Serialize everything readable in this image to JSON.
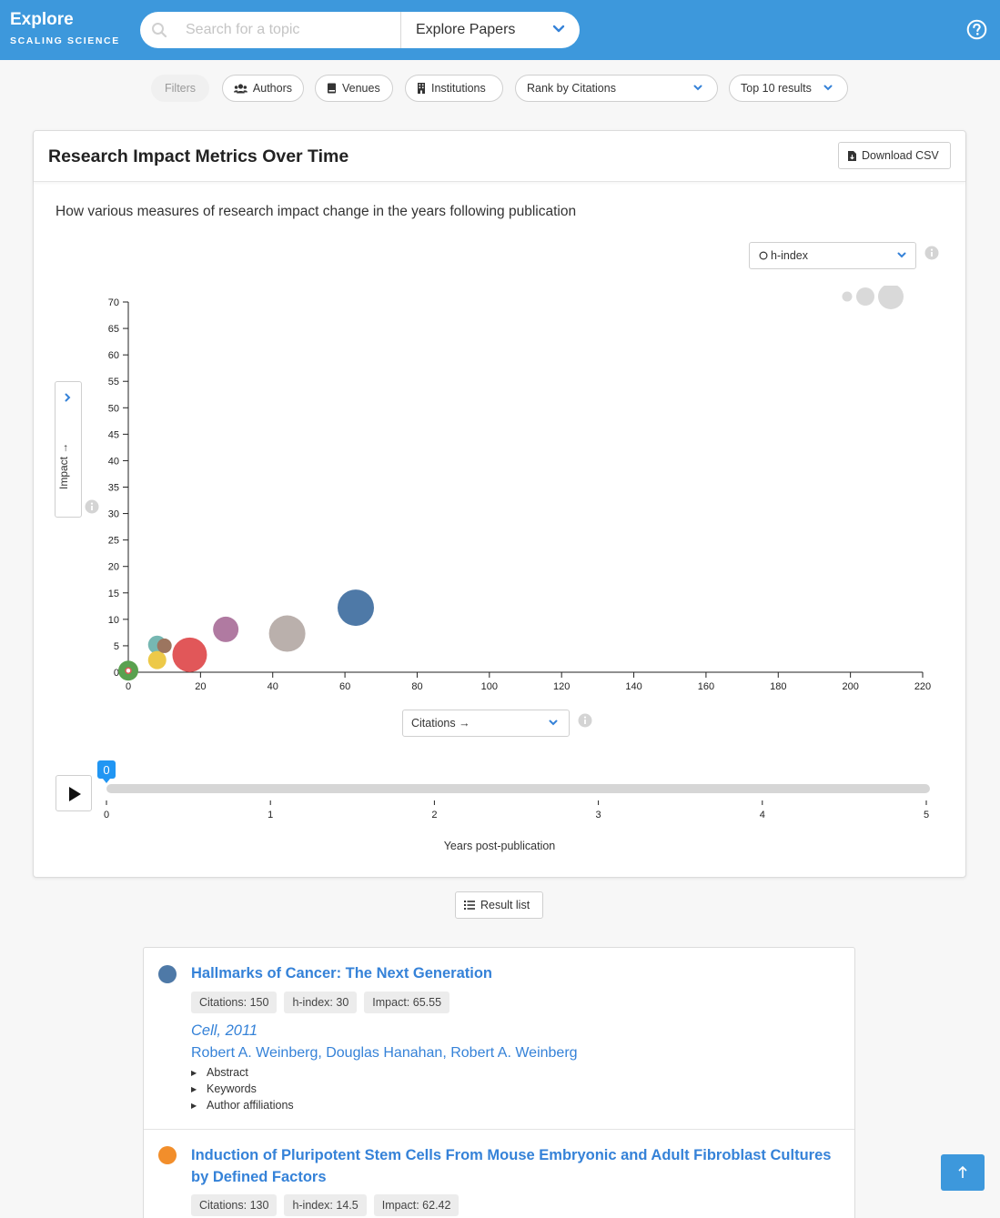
{
  "brand": {
    "title": "Explore",
    "subtitle": "SCALING SCIENCE"
  },
  "search": {
    "placeholder": "Search for a topic",
    "value": ""
  },
  "mode": {
    "selected": "Explore Papers"
  },
  "icons": {
    "search": "search-icon",
    "help": "help-circle-icon",
    "chevron": "chevron-down-icon",
    "info": "info-icon",
    "play": "play-icon",
    "list": "list-icon",
    "file": "file-download-icon",
    "arrow_up": "arrow-up-icon"
  },
  "filters": {
    "label": "Filters",
    "authors": "Authors",
    "venues": "Venues",
    "institutions": "Institutions",
    "rank": "Rank by Citations",
    "top": "Top 10 results"
  },
  "card": {
    "title": "Research Impact Metrics Over Time",
    "download": "Download CSV",
    "description": "How various measures of research impact change in the years following publication",
    "size_select": "h-index",
    "y_axis_toggle": "Impact →",
    "x_axis_select": "Citations →"
  },
  "chart_data": {
    "type": "scatter",
    "xlabel": "Citations →",
    "ylabel": "Impact →",
    "size_label": "h-index",
    "xlim": [
      0,
      220
    ],
    "ylim": [
      0,
      70
    ],
    "x_ticks": [
      0,
      20,
      40,
      60,
      80,
      100,
      120,
      140,
      160,
      180,
      200,
      220
    ],
    "y_ticks": [
      0,
      5,
      10,
      15,
      20,
      25,
      30,
      35,
      40,
      45,
      50,
      55,
      60,
      65,
      70
    ],
    "series": [
      {
        "color": "#4e79a7",
        "x": 63,
        "y": 12.2,
        "size": 20
      },
      {
        "color": "#bab0ac",
        "x": 44,
        "y": 7.3,
        "size": 20
      },
      {
        "color": "#b07aa1",
        "x": 27,
        "y": 8.1,
        "size": 14
      },
      {
        "color": "#e15759",
        "x": 17,
        "y": 3.3,
        "size": 19
      },
      {
        "color": "#76b7b2",
        "x": 8,
        "y": 5.2,
        "size": 10
      },
      {
        "color": "#edc948",
        "x": 8,
        "y": 2.3,
        "size": 10
      },
      {
        "color": "#9c755f",
        "x": 10,
        "y": 5.0,
        "size": 8
      },
      {
        "color": "#59a14f",
        "x": 0,
        "y": 0.3,
        "size": 11
      }
    ],
    "size_legend": [
      4,
      8,
      12
    ],
    "grid": false
  },
  "timeline": {
    "value": "0",
    "ticks": [
      "0",
      "1",
      "2",
      "3",
      "4",
      "5"
    ],
    "caption": "Years post-publication"
  },
  "result_list_button": "Result list",
  "results": [
    {
      "color": "#4e79a7",
      "title": "Hallmarks of Cancer: The Next Generation",
      "tags": [
        "Citations: 150",
        "h-index: 30",
        "Impact: 65.55"
      ],
      "venue": "Cell, 2011",
      "authors": "Robert A. Weinberg, Douglas Hanahan, Robert A. Weinberg",
      "details": [
        "Abstract",
        "Keywords",
        "Author affiliations"
      ]
    },
    {
      "color": "#f28e2b",
      "title": "Induction of Pluripotent Stem Cells From Mouse Embryonic and Adult Fibroblast Cultures by Defined Factors",
      "tags": [
        "Citations: 130",
        "h-index: 14.5",
        "Impact: 62.42"
      ]
    }
  ]
}
